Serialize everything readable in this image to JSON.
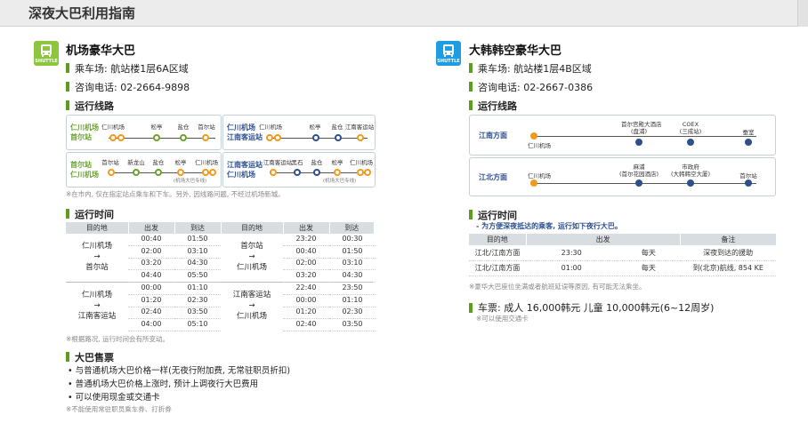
{
  "page_title": "深夜大巴利用指南",
  "left": {
    "badge": "SHUTTLE",
    "title": "机场豪华大巴",
    "stop": "乘车场: 航站楼1层6A区域",
    "phone": "咨询电话: 02-2664-9898",
    "route_title": "运行线路",
    "r1": {
      "label": [
        "仁川机场",
        "首尔站"
      ],
      "stations": [
        "仁川机场",
        "松亭",
        "盐仓",
        "首尔站"
      ]
    },
    "r2": {
      "label": [
        "仁川机场",
        "江南客运站"
      ],
      "stations": [
        "仁川机场",
        "松亭",
        "盐仓",
        "江南客运站"
      ]
    },
    "r3": {
      "label": [
        "首尔站",
        "仁川机场"
      ],
      "stations": [
        "首尔站",
        "新龙山",
        "盐仓",
        "松亭",
        "仁川机场"
      ],
      "sub": "(机场大巴专线)"
    },
    "r4": {
      "label": [
        "江南客运站",
        "仁川机场"
      ],
      "stations": [
        "江南客运站",
        "黑石",
        "盐仓",
        "松亭",
        "仁川机场"
      ],
      "sub": "(机场大巴专线)"
    },
    "route_note": "※在市内, 仅在指定站点乘车和下车。另外, 因线路问题, 不经过机场新城。",
    "time_title": "运行时间",
    "th": [
      "目的地",
      "出发",
      "到达",
      "目的地",
      "出发",
      "到达"
    ],
    "g1": {
      "a": "仁川机场",
      "arr": "→",
      "b": "首尔站",
      "dep": [
        "00:40",
        "02:00",
        "03:20",
        "04:40"
      ],
      "ar": [
        "01:50",
        "03:10",
        "04:30",
        "05:50"
      ]
    },
    "g2": {
      "a": "首尔站",
      "arr": "→",
      "b": "仁川机场",
      "dep": [
        "23:20",
        "00:40",
        "02:00",
        "03:20"
      ],
      "ar": [
        "00:30",
        "01:50",
        "03:10",
        "04:30"
      ]
    },
    "g3": {
      "a": "仁川机场",
      "arr": "→",
      "b": "江南客运站",
      "dep": [
        "00:00",
        "01:20",
        "02:40",
        "04:00"
      ],
      "ar": [
        "01:10",
        "02:30",
        "03:50",
        "05:10"
      ]
    },
    "g4": {
      "a": "江南客运站",
      "arr": "→",
      "b": "仁川机场",
      "dep": [
        "22:40",
        "00:00",
        "01:20",
        "02:40"
      ],
      "ar": [
        "23:50",
        "01:10",
        "02:30",
        "03:50"
      ]
    },
    "time_note": "※根据路况, 运行时间会有所变动。",
    "fare_title": "大巴售票",
    "fares": [
      "• 与普通机场大巴价格一样(无夜行附加费, 无常驻职员折扣)",
      "• 普通机场大巴价格上涨时, 预计上调夜行大巴费用",
      "• 可以使用现金或交通卡"
    ],
    "fare_note": "※不能使用常驻职员乘车券、打折券"
  },
  "right": {
    "badge": "SHUTTLE",
    "title": "大韩韩空豪华大巴",
    "stop": "乘车场: 航站楼1层4B区域",
    "phone": "咨询电话: 02-2667-0386",
    "route_title": "运行线路",
    "r1": {
      "label": "江南方面",
      "stations": [
        [
          "仁川机场"
        ],
        [
          "首尔宫殿大酒店",
          "(盘浦)"
        ],
        [
          "COEX",
          "(三成站)"
        ],
        [
          "蚕室"
        ]
      ]
    },
    "r2": {
      "label": "江北方面",
      "stations": [
        [
          "仁川机场"
        ],
        [
          "麻浦",
          "(首尔花园酒店)"
        ],
        [
          "市政府",
          "(大韩韩空大厦)"
        ],
        [
          "首尔站"
        ]
      ]
    },
    "time_title": "运行时间",
    "time_sub": "- 为方便深夜抵达的乘客, 运行如下夜行大巴。",
    "th": [
      "目的地",
      "出发",
      "备注"
    ],
    "rows": [
      [
        "江北/江南方面",
        "23:30",
        "每天",
        "深夜到达的援助"
      ],
      [
        "江北/江南方面",
        "01:00",
        "每天",
        "到(北京)航线, 854 KE"
      ]
    ],
    "time_note": "※豪华大巴座位坐满或者航班延误等原因, 有可能无法乘坐。",
    "fare": "车票: 成人 16,000韩元 儿童 10,000韩元(6~12周岁)",
    "fare_note": "※可以使用交通卡"
  },
  "colors": {
    "green": "#6aa22e",
    "blue": "#2d4f8c",
    "orange": "#f39a1e",
    "shuttle_green": "#8cc63f",
    "shuttle_blue": "#1e9ee0"
  }
}
